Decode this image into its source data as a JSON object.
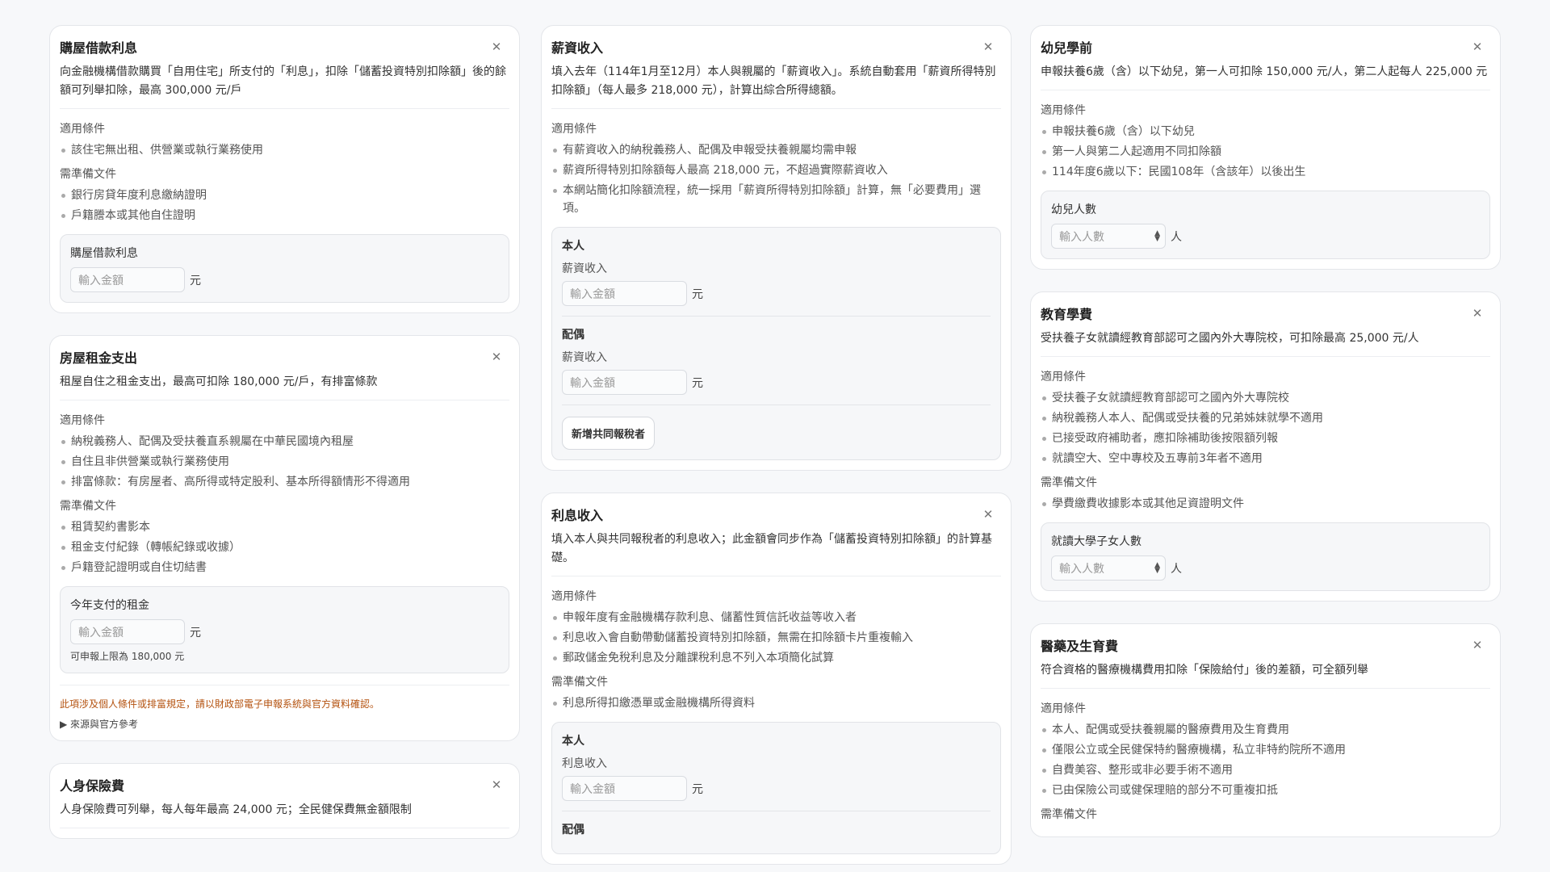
{
  "common": {
    "amount_placeholder": "輸入金額",
    "count_placeholder": "輸入人數",
    "currency_unit": "元",
    "person_unit": "人",
    "spin_up": "▲",
    "spin_down": "▼",
    "close_symbol": "✕"
  },
  "mortgage": {
    "title": "購屋借款利息",
    "desc": "向金融機構借款購買「自用住宅」所支付的「利息」，扣除「儲蓄投資特別扣除額」後的餘額可列舉扣除，最高 300,000 元/戶",
    "conditions_title": "適用條件",
    "conditions": [
      "該住宅無出租、供營業或執行業務使用"
    ],
    "docs_title": "需準備文件",
    "docs": [
      "銀行房貸年度利息繳納證明",
      "戶籍謄本或其他自住證明"
    ],
    "input_label": "購屋借款利息"
  },
  "rent": {
    "title": "房屋租金支出",
    "desc": "租屋自住之租金支出，最高可扣除 180,000 元/戶，有排富條款",
    "conditions_title": "適用條件",
    "conditions": [
      "納稅義務人、配偶及受扶養直系親屬在中華民國境內租屋",
      "自住且非供營業或執行業務使用",
      "排富條款：有房屋者、高所得或特定股利、基本所得額情形不得適用"
    ],
    "docs_title": "需準備文件",
    "docs": [
      "租賃契約書影本",
      "租金支付紀錄（轉帳紀錄或收據）",
      "戶籍登記證明或自住切結書"
    ],
    "input_label": "今年支付的租金",
    "hint": "可申報上限為 180,000 元",
    "warning": "此項涉及個人條件或排富規定，請以財政部電子申報系統與官方資料確認。",
    "source_link": "▶ 來源與官方參考"
  },
  "insurance": {
    "title": "人身保險費",
    "desc": "人身保險費可列舉，每人每年最高 24,000 元；全民健保費無金額限制"
  },
  "salary": {
    "title": "薪資收入",
    "desc": "填入去年（114年1月至12月）本人與親屬的「薪資收入」。系統自動套用「薪資所得特別扣除額」（每人最多 218,000 元），計算出綜合所得總額。",
    "conditions_title": "適用條件",
    "conditions": [
      "有薪資收入的納稅義務人、配偶及申報受扶養親屬均需申報",
      "薪資所得特別扣除額每人最高 218,000 元，不超過實際薪資收入",
      "本網站簡化扣除額流程，統一採用「薪資所得特別扣除額」計算，無「必要費用」選項。"
    ],
    "self_label": "本人",
    "spouse_label": "配偶",
    "field_label": "薪資收入",
    "add_button": "新增共同報稅者"
  },
  "interest": {
    "title": "利息收入",
    "desc": "填入本人與共同報稅者的利息收入；此金額會同步作為「儲蓄投資特別扣除額」的計算基礎。",
    "conditions_title": "適用條件",
    "conditions": [
      "申報年度有金融機構存款利息、儲蓄性質信託收益等收入者",
      "利息收入會自動帶動儲蓄投資特別扣除額，無需在扣除額卡片重複輸入",
      "郵政儲金免稅利息及分離課稅利息不列入本項簡化試算"
    ],
    "docs_title": "需準備文件",
    "docs": [
      "利息所得扣繳憑單或金融機構所得資料"
    ],
    "self_label": "本人",
    "spouse_label": "配偶",
    "field_label": "利息收入"
  },
  "preschool": {
    "title": "幼兒學前",
    "desc": "申報扶養6歲（含）以下幼兒，第一人可扣除 150,000 元/人，第二人起每人 225,000 元",
    "conditions_title": "適用條件",
    "conditions": [
      "申報扶養6歲（含）以下幼兒",
      "第一人與第二人起適用不同扣除額",
      "114年度6歲以下：民國108年（含該年）以後出生"
    ],
    "input_label": "幼兒人數"
  },
  "tuition": {
    "title": "教育學費",
    "desc": "受扶養子女就讀經教育部認可之國內外大專院校，可扣除最高 25,000 元/人",
    "conditions_title": "適用條件",
    "conditions": [
      "受扶養子女就讀經教育部認可之國內外大專院校",
      "納稅義務人本人、配偶或受扶養的兄弟姊妹就學不適用",
      "已接受政府補助者，應扣除補助後按限額列報",
      "就讀空大、空中專校及五專前3年者不適用"
    ],
    "docs_title": "需準備文件",
    "docs": [
      "學費繳費收據影本或其他足資證明文件"
    ],
    "input_label": "就讀大學子女人數"
  },
  "medical": {
    "title": "醫藥及生育費",
    "desc": "符合資格的醫療機構費用扣除「保險給付」後的差額，可全額列舉",
    "conditions_title": "適用條件",
    "conditions": [
      "本人、配偶或受扶養親屬的醫療費用及生育費用",
      "僅限公立或全民健保特約醫療機構，私立非特約院所不適用",
      "自費美容、整形或非必要手術不適用",
      "已由保險公司或健保理賠的部分不可重複扣抵"
    ],
    "docs_title": "需準備文件"
  }
}
